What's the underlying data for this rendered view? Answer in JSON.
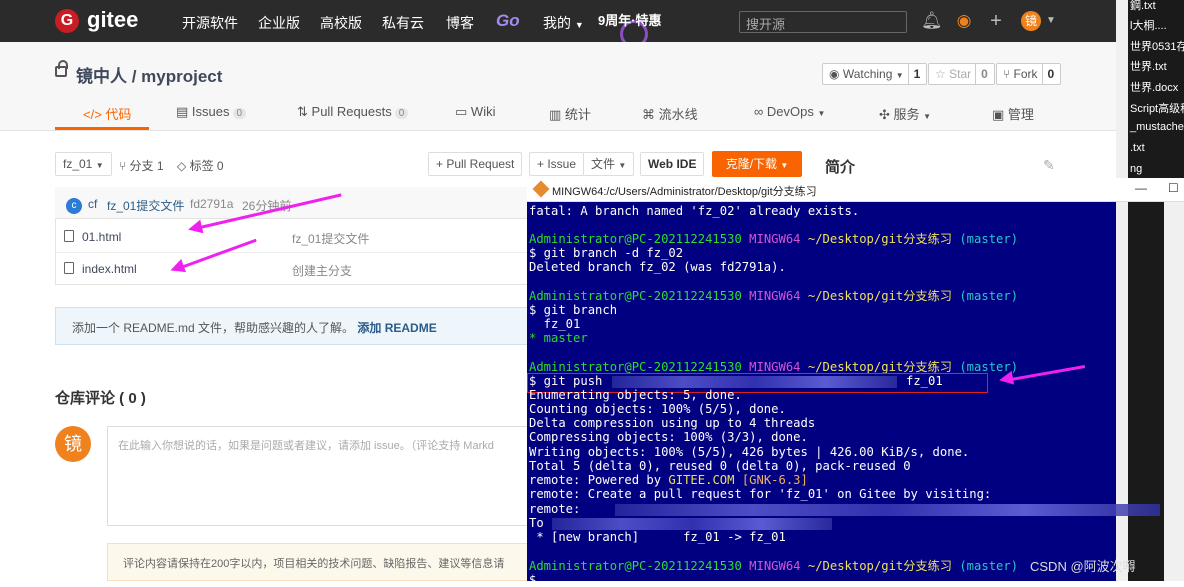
{
  "nav": {
    "brand": "gitee",
    "items": [
      "开源软件",
      "企业版",
      "高校版",
      "私有云",
      "博客"
    ],
    "go": "Go",
    "mine": "我的",
    "anniversary": "9周年·特惠",
    "search_placeholder": "搜开源",
    "user_initial": "镜"
  },
  "desktop_files": [
    "鋼.txt",
    "l大桐....",
    "世界0531存",
    "世界.txt",
    "世界.docx",
    "Script高级程",
    "_mustache|",
    ".txt",
    "ng"
  ],
  "project": {
    "title": "镜中人 / myproject",
    "watching_label": "Watching",
    "watching_count": "1",
    "star_label": "Star",
    "star_count": "0",
    "fork_label": "Fork",
    "fork_count": "0",
    "tabs": [
      {
        "label": "代码",
        "icon": "code-icon"
      },
      {
        "label": "Issues",
        "badge": "0"
      },
      {
        "label": "Pull Requests",
        "badge": "0"
      },
      {
        "label": "Wiki"
      },
      {
        "label": "统计"
      },
      {
        "label": "流水线"
      },
      {
        "label": "DevOps"
      },
      {
        "label": "服务"
      },
      {
        "label": "管理"
      }
    ]
  },
  "toolbar": {
    "branch": "fz_01",
    "branches": "分支 1",
    "tags": "标签 0",
    "pull_request": "+ Pull Request",
    "issue": "+ Issue",
    "file": "文件",
    "web_ide": "Web IDE",
    "clone": "克隆/下载",
    "intro": "简介"
  },
  "commit": {
    "avatar": "c",
    "author": "cf",
    "message": "fz_01提交文件",
    "hash": "fd2791a",
    "time": "26分钟前"
  },
  "files": [
    {
      "name": "01.html",
      "message": "fz_01提交文件"
    },
    {
      "name": "index.html",
      "message": "创建主分支"
    }
  ],
  "readme": {
    "text": "添加一个 README.md 文件，帮助感兴趣的人了解。",
    "link": "添加 README"
  },
  "comments": {
    "title": "仓库评论 ( 0 )",
    "avatar": "镜",
    "placeholder": "在此输入你想说的话，如果是问题或者建议，请添加 issue。（评论支持 Markd",
    "notice": "评论内容请保持在200字以内，项目相关的技术问题、缺陷报告、建议等信息请"
  },
  "terminal": {
    "title": "MINGW64:/c/Users/Administrator/Desktop/git分支练习",
    "user": "Administrator@PC-202112241530",
    "shell": "MINGW64",
    "path": "~/Desktop/git分支练习",
    "branch": "(master)",
    "lines": {
      "l1": "fatal: A branch named 'fz_02' already exists.",
      "l3": "$ git branch -d fz_02",
      "l4": "Deleted branch fz_02 (was fd2791a).",
      "l6": "$ git branch",
      "l7": "  fz_01",
      "l8": "* master",
      "l10a": "$ git push",
      "l10b": "fz_01",
      "l11": "Enumerating objects: 5, done.",
      "l12": "Counting objects: 100% (5/5), done.",
      "l13": "Delta compression using up to 4 threads",
      "l14": "Compressing objects: 100% (3/3), done.",
      "l15": "Writing objects: 100% (5/5), 426 bytes | 426.00 KiB/s, done.",
      "l16": "Total 5 (delta 0), reused 0 (delta 0), pack-reused 0",
      "l17a": "remote: Powered by ",
      "l17b": "GITEE.COM",
      "l17c": "[GNK-6.3]",
      "l18": "remote: Create a pull request for 'fz_01' on Gitee by visiting:",
      "l19": "remote:",
      "l20": "To",
      "l21": " * [new branch]      fz_01 -> fz_01",
      "l23": "$"
    }
  },
  "watermark": "CSDN @阿波次嘚"
}
